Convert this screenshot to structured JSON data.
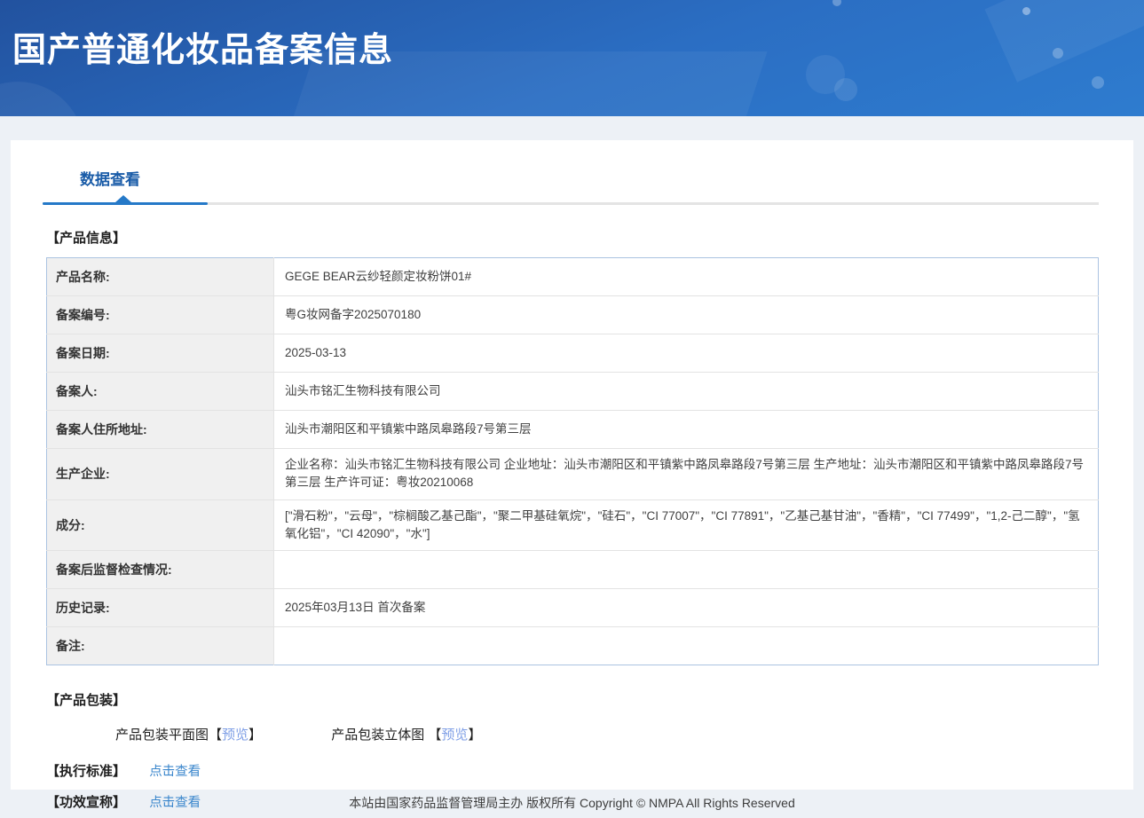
{
  "colors": {
    "banner_gradient_top": "#22529f",
    "banner_gradient_bottom": "#2e7ccf",
    "tab_active_text": "#1a5ca8",
    "tab_underline_blue": "#2579c8",
    "table_border_blue": "#abc3e1",
    "label_cell_bg": "#f0f0f0",
    "preview_link_blue": "#7f9fe6",
    "view_link_blue": "#3a86cc",
    "page_bg": "#edf1f6"
  },
  "header": {
    "title": "国产普通化妆品备案信息"
  },
  "tabs": [
    {
      "label": "数据查看",
      "active": true
    }
  ],
  "product_info": {
    "section_title": "【产品信息】",
    "rows": [
      {
        "label": "产品名称:",
        "value": "GEGE BEAR云纱轻颜定妆粉饼01#"
      },
      {
        "label": "备案编号:",
        "value": "粤G妆网备字2025070180"
      },
      {
        "label": "备案日期:",
        "value": "2025-03-13"
      },
      {
        "label": "备案人:",
        "value": "汕头市铭汇生物科技有限公司"
      },
      {
        "label": "备案人住所地址:",
        "value": "汕头市潮阳区和平镇紫中路凤皋路段7号第三层"
      },
      {
        "label": "生产企业:",
        "value": "企业名称：汕头市铭汇生物科技有限公司 企业地址：汕头市潮阳区和平镇紫中路凤皋路段7号第三层 生产地址：汕头市潮阳区和平镇紫中路凤皋路段7号第三层 生产许可证：粤妆20210068"
      },
      {
        "label": "成分:",
        "value": "[\"滑石粉\"，\"云母\"，\"棕榈酸乙基己酯\"，\"聚二甲基硅氧烷\"，\"硅石\"，\"CI 77007\"，\"CI 77891\"，\"乙基己基甘油\"，\"香精\"，\"CI 77499\"，\"1,2-己二醇\"，\"氢氧化铝\"，\"CI 42090\"，\"水\"]"
      },
      {
        "label": "备案后监督检查情况:",
        "value": ""
      },
      {
        "label": "历史记录:",
        "value": "2025年03月13日 首次备案"
      },
      {
        "label": "备注:",
        "value": ""
      }
    ]
  },
  "packaging": {
    "section_title": "【产品包装】",
    "items": [
      {
        "label": "产品包装平面图",
        "bracket_open": "【",
        "link": "预览",
        "bracket_close": "】"
      },
      {
        "label": "产品包装立体图 ",
        "bracket_open": "【",
        "link": "预览",
        "bracket_close": "】"
      }
    ]
  },
  "exec_standard": {
    "label": "【执行标准】",
    "link": "点击查看"
  },
  "efficacy_claim": {
    "label": "【功效宣称】",
    "link": "点击查看"
  },
  "footer": {
    "text": "本站由国家药品监督管理局主办 版权所有 Copyright © NMPA All Rights Reserved"
  }
}
